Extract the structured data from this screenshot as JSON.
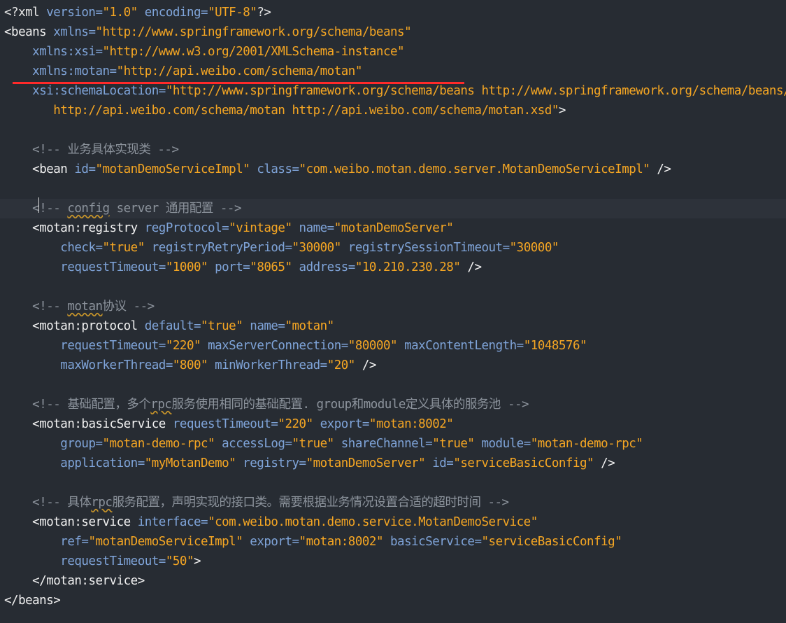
{
  "lines": [
    {
      "tokens": [
        {
          "t": "<?xml ",
          "c": "pi"
        },
        {
          "t": "version=",
          "c": "attr"
        },
        {
          "t": "\"1.0\"",
          "c": "val"
        },
        {
          "t": " encoding=",
          "c": "attr"
        },
        {
          "t": "\"UTF-8\"",
          "c": "val"
        },
        {
          "t": "?>",
          "c": "pi"
        }
      ]
    },
    {
      "tokens": [
        {
          "t": "<beans ",
          "c": "tag"
        },
        {
          "t": "xmlns=",
          "c": "attr"
        },
        {
          "t": "\"http://www.springframework.org/schema/beans\"",
          "c": "val"
        }
      ]
    },
    {
      "tokens": [
        {
          "t": "    ",
          "c": "text"
        },
        {
          "t": "xmlns:xsi=",
          "c": "attr"
        },
        {
          "t": "\"http://www.w3.org/2001/XMLSchema-instance\"",
          "c": "val"
        }
      ]
    },
    {
      "tokens": [
        {
          "t": "    ",
          "c": "text"
        },
        {
          "t": "xmlns:motan=",
          "c": "attr"
        },
        {
          "t": "\"http://api.weibo.com/schema/motan\"",
          "c": "val"
        }
      ]
    },
    {
      "tokens": [
        {
          "t": "    ",
          "c": "text"
        },
        {
          "t": "xsi:schemaLocation=",
          "c": "attr"
        },
        {
          "t": "\"http://www.springframework.org/schema/beans http://www.springframework.org/schema/beans/spring-beans.xsd",
          "c": "val"
        }
      ]
    },
    {
      "tokens": [
        {
          "t": "       ",
          "c": "text"
        },
        {
          "t": "http://api.weibo.com/schema/motan http://api.weibo.com/schema/motan.xsd\"",
          "c": "val"
        },
        {
          "t": ">",
          "c": "tag"
        }
      ]
    },
    {
      "tokens": []
    },
    {
      "tokens": [
        {
          "t": "    ",
          "c": "text"
        },
        {
          "t": "<!-- 业务具体实现类 -->",
          "c": "com"
        }
      ]
    },
    {
      "tokens": [
        {
          "t": "    ",
          "c": "text"
        },
        {
          "t": "<bean ",
          "c": "tag"
        },
        {
          "t": "id=",
          "c": "attr"
        },
        {
          "t": "\"motanDemoServiceImpl\"",
          "c": "val"
        },
        {
          "t": " class=",
          "c": "attr"
        },
        {
          "t": "\"com.weibo.motan.demo.server.MotanDemoServiceImpl\"",
          "c": "val"
        },
        {
          "t": " />",
          "c": "tag"
        }
      ]
    },
    {
      "tokens": []
    },
    {
      "current": true,
      "tokens": [
        {
          "t": "    ",
          "c": "text"
        },
        {
          "t": "<!-- ",
          "c": "com"
        },
        {
          "t": "config",
          "c": "com",
          "sq": true
        },
        {
          "t": " server 通用配置 -->",
          "c": "com"
        }
      ]
    },
    {
      "tokens": [
        {
          "t": "    ",
          "c": "text"
        },
        {
          "t": "<motan:registry ",
          "c": "tag"
        },
        {
          "t": "regProtocol=",
          "c": "attr"
        },
        {
          "t": "\"vintage\"",
          "c": "val"
        },
        {
          "t": " name=",
          "c": "attr"
        },
        {
          "t": "\"motanDemoServer\"",
          "c": "val"
        }
      ]
    },
    {
      "tokens": [
        {
          "t": "        ",
          "c": "text"
        },
        {
          "t": "check=",
          "c": "attr"
        },
        {
          "t": "\"true\"",
          "c": "val"
        },
        {
          "t": " registryRetryPeriod=",
          "c": "attr"
        },
        {
          "t": "\"30000\"",
          "c": "val"
        },
        {
          "t": " registrySessionTimeout=",
          "c": "attr"
        },
        {
          "t": "\"30000\"",
          "c": "val"
        }
      ]
    },
    {
      "tokens": [
        {
          "t": "        ",
          "c": "text"
        },
        {
          "t": "requestTimeout=",
          "c": "attr"
        },
        {
          "t": "\"1000\"",
          "c": "val"
        },
        {
          "t": " port=",
          "c": "attr"
        },
        {
          "t": "\"8065\"",
          "c": "val"
        },
        {
          "t": " address=",
          "c": "attr"
        },
        {
          "t": "\"10.210.230.28\"",
          "c": "val"
        },
        {
          "t": " />",
          "c": "tag"
        }
      ]
    },
    {
      "tokens": []
    },
    {
      "tokens": [
        {
          "t": "    ",
          "c": "text"
        },
        {
          "t": "<!-- ",
          "c": "com"
        },
        {
          "t": "motan",
          "c": "com",
          "sq": true
        },
        {
          "t": "协议 -->",
          "c": "com"
        }
      ]
    },
    {
      "tokens": [
        {
          "t": "    ",
          "c": "text"
        },
        {
          "t": "<motan:protocol ",
          "c": "tag"
        },
        {
          "t": "default=",
          "c": "attr"
        },
        {
          "t": "\"true\"",
          "c": "val"
        },
        {
          "t": " name=",
          "c": "attr"
        },
        {
          "t": "\"motan\"",
          "c": "val"
        }
      ]
    },
    {
      "tokens": [
        {
          "t": "        ",
          "c": "text"
        },
        {
          "t": "requestTimeout=",
          "c": "attr"
        },
        {
          "t": "\"220\"",
          "c": "val"
        },
        {
          "t": " maxServerConnection=",
          "c": "attr"
        },
        {
          "t": "\"80000\"",
          "c": "val"
        },
        {
          "t": " maxContentLength=",
          "c": "attr"
        },
        {
          "t": "\"1048576\"",
          "c": "val"
        }
      ]
    },
    {
      "tokens": [
        {
          "t": "        ",
          "c": "text"
        },
        {
          "t": "maxWorkerThread=",
          "c": "attr"
        },
        {
          "t": "\"800\"",
          "c": "val"
        },
        {
          "t": " minWorkerThread=",
          "c": "attr"
        },
        {
          "t": "\"20\"",
          "c": "val"
        },
        {
          "t": " />",
          "c": "tag"
        }
      ]
    },
    {
      "tokens": []
    },
    {
      "tokens": [
        {
          "t": "    ",
          "c": "text"
        },
        {
          "t": "<!-- 基础配置，多个",
          "c": "com"
        },
        {
          "t": "rpc",
          "c": "com",
          "sq": true
        },
        {
          "t": "服务使用相同的基础配置. group和module定义具体的服务池 -->",
          "c": "com"
        }
      ]
    },
    {
      "tokens": [
        {
          "t": "    ",
          "c": "text"
        },
        {
          "t": "<motan:basicService ",
          "c": "tag"
        },
        {
          "t": "requestTimeout=",
          "c": "attr"
        },
        {
          "t": "\"220\"",
          "c": "val"
        },
        {
          "t": " export=",
          "c": "attr"
        },
        {
          "t": "\"motan:8002\"",
          "c": "val"
        }
      ]
    },
    {
      "tokens": [
        {
          "t": "        ",
          "c": "text"
        },
        {
          "t": "group=",
          "c": "attr"
        },
        {
          "t": "\"motan-demo-rpc\"",
          "c": "val"
        },
        {
          "t": " accessLog=",
          "c": "attr"
        },
        {
          "t": "\"true\"",
          "c": "val"
        },
        {
          "t": " shareChannel=",
          "c": "attr"
        },
        {
          "t": "\"true\"",
          "c": "val"
        },
        {
          "t": " module=",
          "c": "attr"
        },
        {
          "t": "\"motan-demo-rpc\"",
          "c": "val"
        }
      ]
    },
    {
      "tokens": [
        {
          "t": "        ",
          "c": "text"
        },
        {
          "t": "application=",
          "c": "attr"
        },
        {
          "t": "\"myMotanDemo\"",
          "c": "val"
        },
        {
          "t": " registry=",
          "c": "attr"
        },
        {
          "t": "\"motanDemoServer\"",
          "c": "val"
        },
        {
          "t": " id=",
          "c": "attr"
        },
        {
          "t": "\"serviceBasicConfig\"",
          "c": "val"
        },
        {
          "t": " />",
          "c": "tag"
        }
      ]
    },
    {
      "tokens": []
    },
    {
      "tokens": [
        {
          "t": "    ",
          "c": "text"
        },
        {
          "t": "<!-- 具体",
          "c": "com"
        },
        {
          "t": "rpc",
          "c": "com",
          "sq": true
        },
        {
          "t": "服务配置，声明实现的接口类。需要根据业务情况设置合适的超时时间 -->",
          "c": "com"
        }
      ]
    },
    {
      "tokens": [
        {
          "t": "    ",
          "c": "text"
        },
        {
          "t": "<motan:service ",
          "c": "tag"
        },
        {
          "t": "interface=",
          "c": "attr"
        },
        {
          "t": "\"com.weibo.motan.demo.service.MotanDemoService\"",
          "c": "val"
        }
      ]
    },
    {
      "tokens": [
        {
          "t": "        ",
          "c": "text"
        },
        {
          "t": "ref=",
          "c": "attr"
        },
        {
          "t": "\"motanDemoServiceImpl\"",
          "c": "val"
        },
        {
          "t": " export=",
          "c": "attr"
        },
        {
          "t": "\"motan:8002\"",
          "c": "val"
        },
        {
          "t": " basicService=",
          "c": "attr"
        },
        {
          "t": "\"serviceBasicConfig\"",
          "c": "val"
        }
      ]
    },
    {
      "tokens": [
        {
          "t": "        ",
          "c": "text"
        },
        {
          "t": "requestTimeout=",
          "c": "attr"
        },
        {
          "t": "\"50\"",
          "c": "val"
        },
        {
          "t": ">",
          "c": "tag"
        }
      ]
    },
    {
      "tokens": [
        {
          "t": "    ",
          "c": "text"
        },
        {
          "t": "</motan:service>",
          "c": "tag"
        }
      ]
    },
    {
      "tokens": [
        {
          "t": "</beans>",
          "c": "tag"
        }
      ]
    }
  ],
  "colors": {
    "background": "#272c33",
    "current_line": "#2d323a",
    "attribute": "#7fa4d9",
    "value": "#f5a623",
    "comment": "#8c939c",
    "tag": "#f2f2f2",
    "annotation": "#ff2a2a"
  }
}
